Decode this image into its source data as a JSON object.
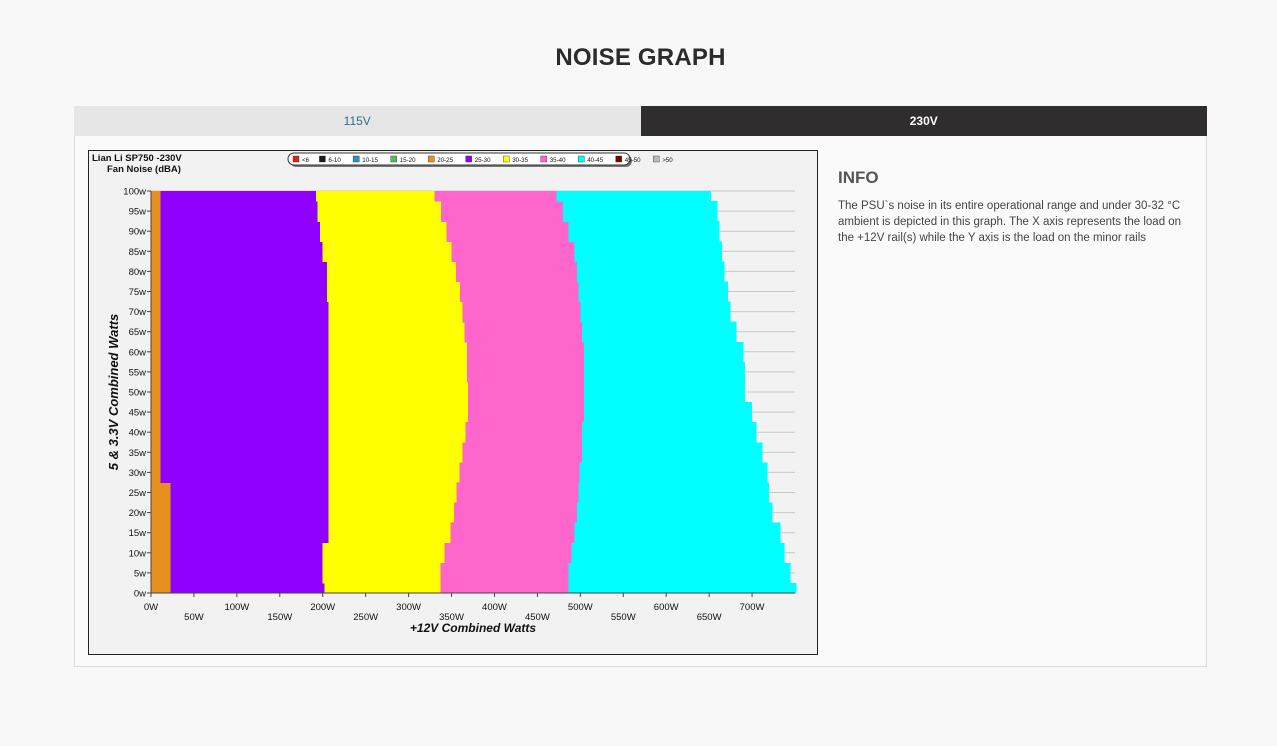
{
  "page": {
    "title": "NOISE GRAPH"
  },
  "tabs": [
    {
      "label": "115V",
      "active": false
    },
    {
      "label": "230V",
      "active": true
    }
  ],
  "info": {
    "heading": "INFO",
    "text": "The PSU`s noise in its entire operational range and under 30-32 °C ambient is depicted in this graph. The X axis represents the load on the +12V rail(s) while the Y axis is the load on the minor rails"
  },
  "chart_data": {
    "type": "heatmap",
    "title_line1": "Lian Li SP750 -230V",
    "title_line2": "Fan Noise (dBA)",
    "xlabel": "+12V Combined Watts",
    "ylabel": "5 & 3.3V Combined Watts",
    "xlim": [
      0,
      750
    ],
    "ylim": [
      0,
      100
    ],
    "x_ticks": [
      "0W",
      "50W",
      "100W",
      "150W",
      "200W",
      "250W",
      "300W",
      "350W",
      "400W",
      "450W",
      "500W",
      "550W",
      "600W",
      "650W",
      "700W"
    ],
    "x_tick_values": [
      0,
      50,
      100,
      150,
      200,
      250,
      300,
      350,
      400,
      450,
      500,
      550,
      600,
      650,
      700
    ],
    "y_ticks": [
      "0w",
      "5w",
      "10w",
      "15w",
      "20w",
      "25w",
      "30w",
      "35w",
      "40w",
      "45w",
      "50w",
      "55w",
      "60w",
      "65w",
      "70w",
      "75w",
      "80w",
      "85w",
      "90w",
      "95w",
      "100w"
    ],
    "y_tick_values": [
      0,
      5,
      10,
      15,
      20,
      25,
      30,
      35,
      40,
      45,
      50,
      55,
      60,
      65,
      70,
      75,
      80,
      85,
      90,
      95,
      100
    ],
    "legend": [
      {
        "label": "<6",
        "color": "#e02020"
      },
      {
        "label": "6-10",
        "color": "#1a1a1a"
      },
      {
        "label": "10-15",
        "color": "#2a8fd0"
      },
      {
        "label": "15-20",
        "color": "#5cb85c"
      },
      {
        "label": "20-25",
        "color": "#e8901e"
      },
      {
        "label": "25-30",
        "color": "#9000ff"
      },
      {
        "label": "30-35",
        "color": "#ffff00"
      },
      {
        "label": "35-40",
        "color": "#ff66cc"
      },
      {
        "label": "40-45",
        "color": "#00ffff"
      },
      {
        "label": "45-50",
        "color": "#7a0000"
      },
      {
        "label": ">50",
        "color": "#bbbbbb"
      }
    ],
    "y_levels": [
      0,
      5,
      10,
      15,
      20,
      25,
      30,
      35,
      40,
      45,
      50,
      55,
      60,
      65,
      70,
      75,
      80,
      85,
      90,
      95,
      100
    ],
    "boundaries": {
      "b_20_25_to_25_30": [
        23,
        23,
        23,
        23,
        23,
        23,
        11,
        11,
        11,
        11,
        11,
        11,
        11,
        11,
        11,
        11,
        11,
        11,
        11,
        11,
        11
      ],
      "b_25_30_to_30_35": [
        202,
        200,
        200,
        207,
        207,
        207,
        207,
        207,
        207,
        207,
        207,
        207,
        207,
        207,
        207,
        205,
        205,
        200,
        197,
        194,
        192
      ],
      "b_30_35_to_35_40": [
        337,
        337,
        342,
        349,
        353,
        356,
        359,
        363,
        366,
        369,
        369,
        368,
        368,
        365,
        363,
        360,
        355,
        350,
        344,
        338,
        330
      ],
      "b_35_40_to_40_45": [
        486,
        486,
        490,
        493,
        496,
        498,
        499,
        502,
        502,
        504,
        504,
        504,
        504,
        502,
        500,
        498,
        496,
        493,
        486,
        480,
        472
      ],
      "max_load": [
        752,
        745,
        738,
        733,
        724,
        720,
        718,
        712,
        705,
        700,
        692,
        692,
        690,
        682,
        675,
        672,
        668,
        665,
        662,
        660,
        652
      ]
    }
  }
}
